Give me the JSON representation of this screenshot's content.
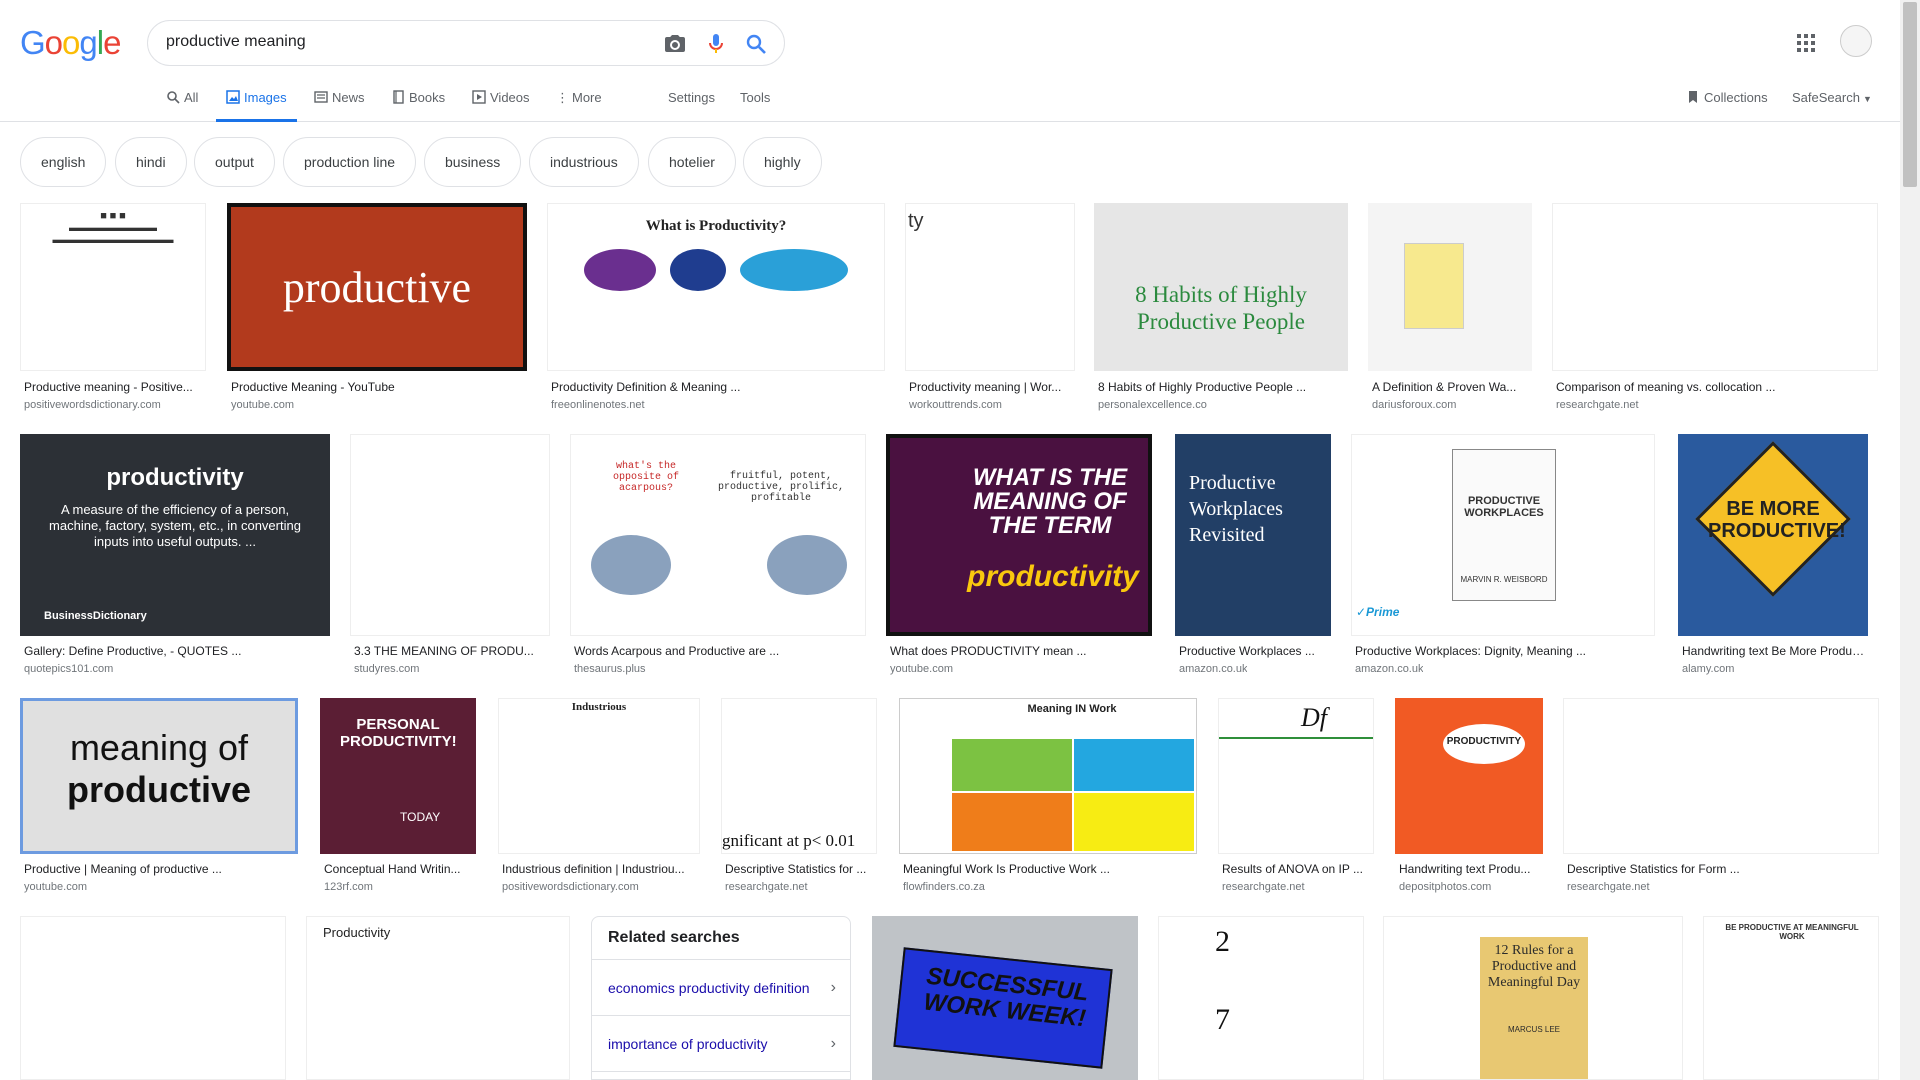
{
  "search": {
    "query": "productive meaning"
  },
  "tabs": [
    {
      "label": "All"
    },
    {
      "label": "Images"
    },
    {
      "label": "News"
    },
    {
      "label": "Books"
    },
    {
      "label": "Videos"
    },
    {
      "label": "More"
    }
  ],
  "tools": {
    "settings": "Settings",
    "tools": "Tools",
    "collections": "Collections",
    "safesearch": "SafeSearch"
  },
  "chips": [
    "english",
    "hindi",
    "output",
    "production line",
    "business",
    "industrious",
    "hotelier",
    "highly"
  ],
  "results": [
    {
      "caption": "Productive meaning - Positive...",
      "source": "positivewordsdictionary.com"
    },
    {
      "caption": "Productive Meaning - YouTube",
      "source": "youtube.com",
      "thumb_text": "productive"
    },
    {
      "caption": "Productivity Definition & Meaning ...",
      "source": "freeonlinenotes.net",
      "thumb_title": "What is Productivity?"
    },
    {
      "caption": "Productivity meaning | Wor...",
      "source": "workouttrends.com"
    },
    {
      "caption": "8 Habits of Highly Productive People ...",
      "source": "personalexcellence.co",
      "thumb_text": "8 Habits of Highly Productive People"
    },
    {
      "caption": "A Definition & Proven Wa...",
      "source": "dariusforoux.com"
    },
    {
      "caption": "Comparison of meaning vs. collocation ...",
      "source": "researchgate.net"
    },
    {
      "caption": "Gallery: Define Productive, - QUOTES ...",
      "source": "quotepics101.com",
      "thumb_text": "productivity",
      "thumb_sub": "A measure of the efficiency of a person, machine, factory, system, etc., in converting inputs into useful outputs. ...",
      "thumb_brand": "BusinessDictionary"
    },
    {
      "caption": "3.3 THE MEANING OF PRODU...",
      "source": "studyres.com"
    },
    {
      "caption": "Words Acarpous and Productive are ...",
      "source": "thesaurus.plus",
      "thumb_q": "what's the opposite of acarpous?",
      "thumb_a": "fruitful, potent, productive, prolific, profitable"
    },
    {
      "caption": "What does PRODUCTIVITY mean ...",
      "source": "youtube.com",
      "thumb_text": "WHAT IS THE MEANING OF THE TERM",
      "thumb_word": "productivity"
    },
    {
      "caption": "Productive Workplaces ...",
      "source": "amazon.co.uk",
      "thumb_text": "Productive Workplaces Revisited"
    },
    {
      "caption": "Productive Workplaces: Dignity, Meaning ...",
      "source": "amazon.co.uk",
      "thumb_text": "PRODUCTIVE WORKPLACES",
      "thumb_author": "MARVIN R. WEISBORD",
      "thumb_badge": "✓Prime"
    },
    {
      "caption": "Handwriting text Be More Produc...",
      "source": "alamy.com",
      "thumb_text": "BE MORE PRODUCTIVE!"
    },
    {
      "caption": "Productive | Meaning of productive ...",
      "source": "youtube.com",
      "thumb_line1": "meaning of",
      "thumb_line2": "productive"
    },
    {
      "caption": "Conceptual Hand Writin...",
      "source": "123rf.com",
      "thumb_text": "PERSONAL PRODUCTIVITY!",
      "thumb_sub": "TODAY"
    },
    {
      "caption": "Industrious definition | Industriou...",
      "source": "positivewordsdictionary.com",
      "thumb_text": "Industrious"
    },
    {
      "caption": "Descriptive Statistics for ...",
      "source": "researchgate.net",
      "thumb_text": "gnificant at p< 0.01"
    },
    {
      "caption": "Meaningful Work Is Productive Work ...",
      "source": "flowfinders.co.za",
      "thumb_text": "Meaning IN Work"
    },
    {
      "caption": "Results of ANOVA on IP ...",
      "source": "researchgate.net",
      "thumb_text": "Df"
    },
    {
      "caption": "Handwriting text Produ...",
      "source": "depositphotos.com",
      "thumb_text": "PRODUCTIVITY"
    },
    {
      "caption": "Descriptive Statistics for Form ...",
      "source": "researchgate.net"
    }
  ],
  "bottom_row": {
    "productivity_title": "Productivity",
    "successful": "SUCCESSFUL WORK WEEK!",
    "rules": "12 Rules for a Productive and Meaningful Day",
    "rules_author": "MARCUS LEE",
    "meaningful": "BE PRODUCTIVE AT MEANINGFUL WORK"
  },
  "related": {
    "title": "Related searches",
    "items": [
      "economics productivity definition",
      "importance of productivity"
    ]
  },
  "colors": {
    "accent": "#1a73e8",
    "link": "#1a0dab",
    "muted": "#70757a"
  }
}
